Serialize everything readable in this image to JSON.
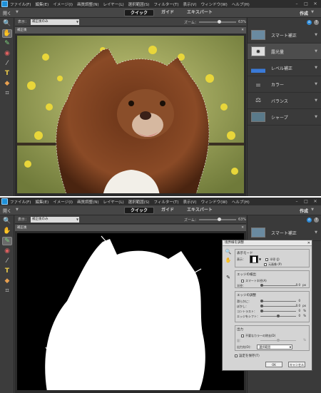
{
  "window1": {
    "menu": [
      "ファイル(F)",
      "編集(E)",
      "イメージ(I)",
      "画質調整(N)",
      "レイヤー(L)",
      "選択範囲(S)",
      "フィルター(T)",
      "表示(V)",
      "ウィンドウ(W)",
      "ヘルプ(H)"
    ],
    "open_label": "開く",
    "tabs": [
      "クイック",
      "ガイド",
      "エキスパート"
    ],
    "active_tab": "クイック",
    "create_label": "作成",
    "view_label": "表示：",
    "view_value": "補正後のみ",
    "zoom_label": "ズーム：",
    "zoom_value": "63%",
    "zoom_fraction": 0.55,
    "doc_title": "補正後",
    "panel_items": [
      "スマート補正",
      "露光量",
      "レベル補正",
      "カラー",
      "バランス",
      "シャープ"
    ]
  },
  "window2": {
    "menu": [
      "ファイル(F)",
      "編集(E)",
      "イメージ(I)",
      "画質調整(N)",
      "レイヤー(L)",
      "選択範囲(S)",
      "フィルター(T)",
      "表示(V)",
      "ウィンドウ(W)",
      "ヘルプ(H)"
    ],
    "open_label": "開く",
    "tabs": [
      "クイック",
      "ガイド",
      "エキスパート"
    ],
    "active_tab": "クイック",
    "create_label": "作成",
    "view_label": "表示：",
    "view_value": "補正後のみ",
    "zoom_label": "ズーム：",
    "zoom_value": "63%",
    "zoom_fraction": 0.55,
    "doc_title": "補正後",
    "panel_items": [
      "スマート補正"
    ]
  },
  "dialog": {
    "title": "境界線を調整",
    "view_mode_label": "表示モード",
    "view_label": "表示：",
    "show_radius": "半径 (J)",
    "show_original": "元画像 (P)",
    "edge_detection_label": "エッジの検出",
    "smart_radius": "スマート半径(A)",
    "radius_label": "半径：",
    "radius_value": "0.0",
    "radius_unit": "px",
    "adjust_edge_label": "エッジの調整",
    "smooth_label": "滑らかに：",
    "smooth_value": "0",
    "feather_label": "ぼかし：",
    "feather_value": "0.0",
    "feather_unit": "px",
    "contrast_label": "コントラスト：",
    "contrast_value": "0",
    "contrast_unit": "%",
    "shift_edge_label": "エッジをシフト：",
    "shift_edge_value": "0",
    "shift_edge_unit": "%",
    "output_label": "出力",
    "decontaminate": "不要なカラーの除去(D)",
    "amount_label": "量：",
    "output_to_label": "出力先(O)：",
    "output_to_value": "選択範囲",
    "remember": "設定を保存(T)",
    "ok": "OK",
    "cancel": "キャンセル"
  }
}
